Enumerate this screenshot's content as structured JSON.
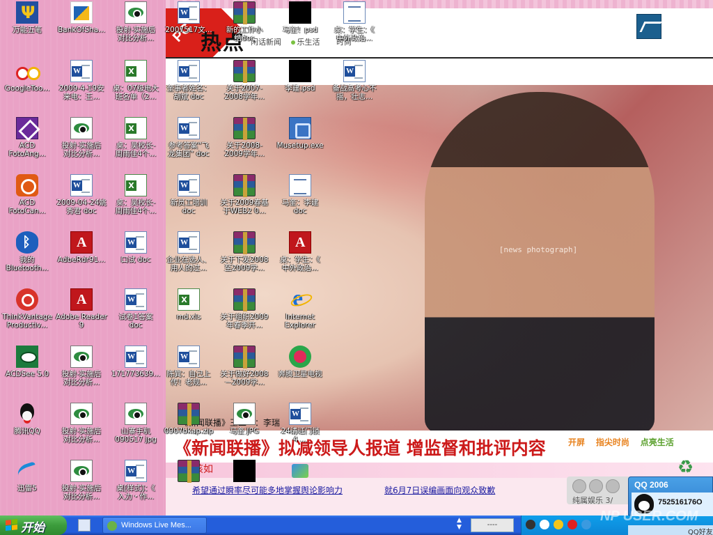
{
  "colors": {
    "taskbar": "#245edb",
    "start": "#3c9c3c",
    "headline": "#cc1a1a",
    "tray": "#0c86d6"
  },
  "news": {
    "corner_label": "PC",
    "hot_title": "热点",
    "hot_sub_items": [
      "闲话新闻",
      "乐生活",
      "时尚"
    ],
    "headline": "《新闻联播》拟减领导人报道 增监督和批评内容",
    "caption_mini": "《新闻联播》王二一：李瑞",
    "caption_pink": "该如",
    "brands": [
      "开屏",
      "指尖时尚",
      "点亮生活"
    ],
    "link_left": "希望通过瞬率尽可能多地掌握舆论影响力",
    "link_right": "就6月7日误编画面向观众致歉",
    "media_label": "纯属娱乐",
    "media_page": "3/"
  },
  "photo": {
    "note": "[news photograph]"
  },
  "icons": [
    {
      "label": "万能五笔",
      "type": "pen"
    },
    {
      "label": "BankOfSha...",
      "type": "bank"
    },
    {
      "label": "投射-实施后\n对比分析...",
      "type": "jpg"
    },
    {
      "label": "GoogleToo...",
      "type": "google"
    },
    {
      "label": "2009-4-19安\n来电：王...",
      "type": "word"
    },
    {
      "label": "桌：07级电大\n班名单（2...",
      "type": "excel"
    },
    {
      "label": "ACD\nFotoAng...",
      "type": "acd"
    },
    {
      "label": "投射-实施后\n对比分析...",
      "type": "jpg"
    },
    {
      "label": "桌：吴校长-\n周雨佳4个...",
      "type": "excel"
    },
    {
      "label": "ACD\nFotoCan...",
      "type": "acdcap"
    },
    {
      "label": "2009-04-24姚\n秀君 doc",
      "type": "word"
    },
    {
      "label": "桌：吴校长-\n周雨佳4个...",
      "type": "excel"
    },
    {
      "label": "我的\nBluetooth...",
      "type": "bt"
    },
    {
      "label": "AdbeRdr91...",
      "type": "pdf"
    },
    {
      "label": "口试 doc",
      "type": "word"
    },
    {
      "label": "ThinkVantage\nProductiv...",
      "type": "think"
    },
    {
      "label": "Adobe Reader\n9",
      "type": "pdf"
    },
    {
      "label": "试卷1答案\ndoc",
      "type": "word"
    },
    {
      "label": "ACDSee 5.0",
      "type": "acdsee"
    },
    {
      "label": "投射-实施后\n对比分析...",
      "type": "jpg"
    },
    {
      "label": "171773639...",
      "type": "word"
    },
    {
      "label": "腾讯QQ",
      "type": "qq"
    },
    {
      "label": "投射-实施后\n对比分析...",
      "type": "jpg"
    },
    {
      "label": "山寨手机\n090517 jpg",
      "type": "jpg"
    },
    {
      "label": "迅雷5",
      "type": "xunlei"
    },
    {
      "label": "投射-实施后\n对比分析...",
      "type": "jpg"
    },
    {
      "label": "桌[样式]：《\n入力・作...",
      "type": "word"
    },
    {
      "label": "2007517文...",
      "type": "word"
    },
    {
      "label": "新的工作小\n结doc",
      "type": "rar"
    },
    {
      "label": "马奎！psd",
      "type": "black"
    },
    {
      "label": "桌：学生：《\n中外政治...",
      "type": "note"
    },
    {
      "label": "奎事者姓名：\n胡斌 doc",
      "type": "word"
    },
    {
      "label": "关于2007-\n2008学年...",
      "type": "rar"
    },
    {
      "label": "李建.psd",
      "type": "black"
    },
    {
      "label": "备战高考心不\n摇，壮志...",
      "type": "word"
    },
    {
      "label": "参考答案“飞\n龙集团” doc",
      "type": "word"
    },
    {
      "label": "关于2008-\n2009学年...",
      "type": "rar"
    },
    {
      "label": "Musetup.exe",
      "type": "musetup"
    },
    {
      "label": "新员工培训\ndoc",
      "type": "word"
    },
    {
      "label": "关于2009春基\n于WEB2 0...",
      "type": "rar"
    },
    {
      "label": "马奎：李建\ndoc",
      "type": "note"
    },
    {
      "label": "企业在选人、\n用人的过...",
      "type": "word"
    },
    {
      "label": "关于下发2008\n至2009学...",
      "type": "rar"
    },
    {
      "label": "桌：学生：《\n中外政治...",
      "type": "pdf"
    },
    {
      "label": "md.xls",
      "type": "excel"
    },
    {
      "label": "关于组织2009\n年春季开...",
      "type": "rar"
    },
    {
      "label": "Internet\nExplorer",
      "type": "ie"
    },
    {
      "label": "陈巽：自己上\n传！老规...",
      "type": "word"
    },
    {
      "label": "关于做好2008\n－2009学...",
      "type": "rar"
    },
    {
      "label": "奔腾卫星电视",
      "type": "benteng"
    },
    {
      "label": "0907bkap.zip",
      "type": "rar"
    },
    {
      "label": "马奎 JPG",
      "type": "jpg"
    },
    {
      "label": "24请证门锁\n4 ...",
      "type": "word"
    },
    {
      "label": "",
      "type": "rar"
    },
    {
      "label": "",
      "type": "black"
    },
    {
      "label": "",
      "type": "install"
    },
    {
      "label": "",
      "type": "recycle"
    }
  ],
  "taskbar": {
    "start_label": "开始",
    "task_label": "Windows Live Mes...",
    "ime": "----"
  },
  "qq": {
    "title": "QQ 2006",
    "number": "752516176O",
    "sub_label": "QQ好友"
  },
  "watermark": "NP USER.COM"
}
